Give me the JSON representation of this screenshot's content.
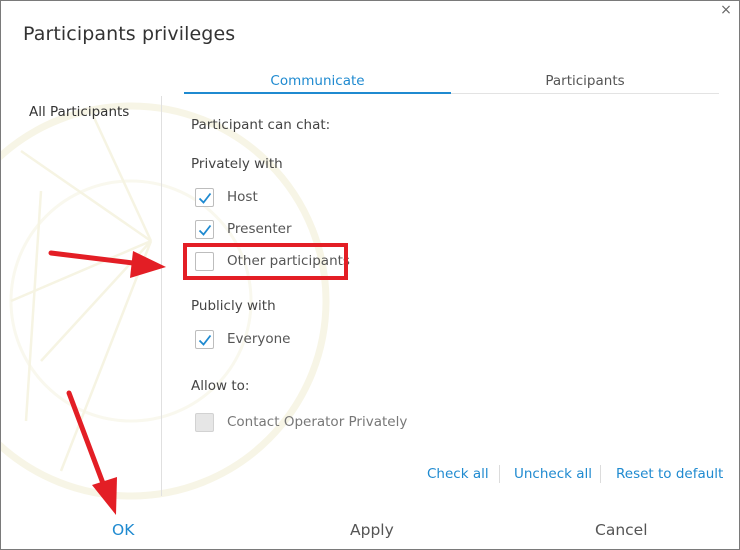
{
  "dialog": {
    "title": "Participants privileges",
    "close_glyph": "×"
  },
  "tabs": [
    {
      "label": "Communicate",
      "active": true
    },
    {
      "label": "Participants",
      "active": false
    }
  ],
  "sidebar": {
    "items": [
      {
        "label": "All Participants",
        "selected": true
      }
    ]
  },
  "communicate": {
    "heading": "Participant can chat:",
    "privately": {
      "label": "Privately with",
      "options": [
        {
          "label": "Host",
          "checked": true
        },
        {
          "label": "Presenter",
          "checked": true
        },
        {
          "label": "Other participants",
          "checked": false,
          "highlighted": true
        }
      ]
    },
    "publicly": {
      "label": "Publicly with",
      "options": [
        {
          "label": "Everyone",
          "checked": true
        }
      ]
    },
    "allow": {
      "label": "Allow to:",
      "options": [
        {
          "label": "Contact Operator Privately",
          "checked": false,
          "disabled": true
        }
      ]
    }
  },
  "links": {
    "check_all": "Check all",
    "uncheck_all": "Uncheck all",
    "reset": "Reset to default"
  },
  "footer": {
    "ok": "OK",
    "apply": "Apply",
    "cancel": "Cancel"
  },
  "colors": {
    "accent": "#1f8ad0",
    "annotation": "#e31e25",
    "check": "#1f8ad0"
  },
  "annotations": [
    {
      "type": "arrow",
      "points_to": "Other participants"
    },
    {
      "type": "arrow",
      "points_to": "OK"
    }
  ]
}
